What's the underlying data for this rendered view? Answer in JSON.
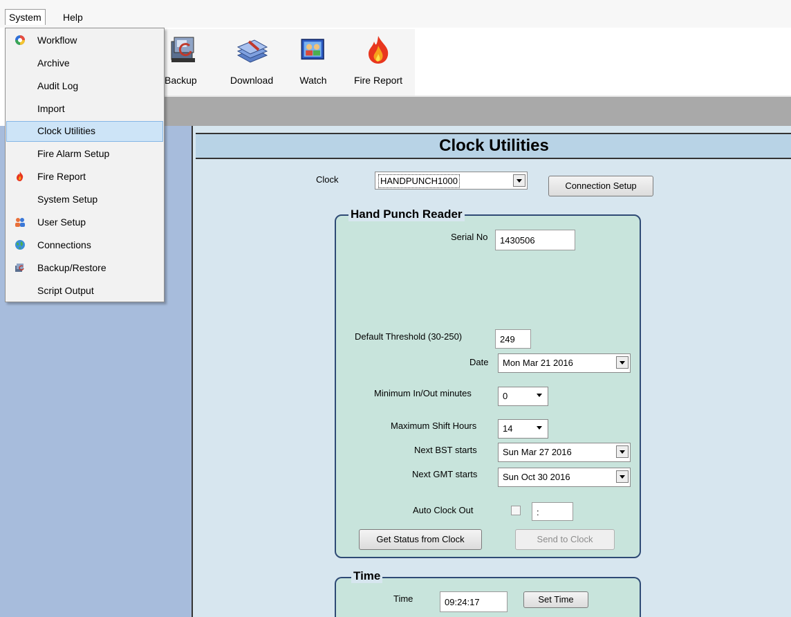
{
  "menubar": {
    "system": "System",
    "help": "Help"
  },
  "toolbar": {
    "buttons": [
      {
        "label": "Backup",
        "icon": "backup-icon"
      },
      {
        "label": "Download",
        "icon": "download-icon"
      },
      {
        "label": "Watch",
        "icon": "watch-icon"
      },
      {
        "label": "Fire Report",
        "icon": "fire-icon"
      }
    ]
  },
  "system_menu": {
    "items": [
      {
        "label": "Workflow",
        "icon": "workflow-icon"
      },
      {
        "label": "Archive"
      },
      {
        "label": "Audit Log"
      },
      {
        "label": "Import"
      },
      {
        "label": "Clock Utilities",
        "selected": true
      },
      {
        "label": "Fire Alarm Setup"
      },
      {
        "label": "Fire Report",
        "icon": "fire-icon"
      },
      {
        "label": "System Setup"
      },
      {
        "label": "User Setup",
        "icon": "users-icon"
      },
      {
        "label": "Connections",
        "icon": "globe-icon"
      },
      {
        "label": "Backup/Restore",
        "icon": "backup-icon"
      },
      {
        "label": "Script Output"
      }
    ]
  },
  "page": {
    "title": "Clock Utilities",
    "clock_label": "Clock",
    "clock_value": "HANDPUNCH1000",
    "connection_setup_label": "Connection Setup"
  },
  "reader": {
    "group_title": "Hand Punch Reader",
    "serial_label": "Serial No",
    "serial_value": "1430506",
    "threshold_label": "Default Threshold (30-250)",
    "threshold_value": "249",
    "date_label": "Date",
    "date_value": "Mon Mar 21 2016",
    "min_inout_label": "Minimum In/Out minutes",
    "min_inout_value": "0",
    "max_shift_label": "Maximum Shift Hours",
    "max_shift_value": "14",
    "bst_label": "Next BST starts",
    "bst_value": "Sun Mar 27 2016",
    "gmt_label": "Next GMT starts",
    "gmt_value": "Sun Oct 30 2016",
    "auto_clock_label": "Auto Clock Out",
    "auto_clock_time": ":",
    "get_status_label": "Get Status from Clock",
    "send_label": "Send to Clock"
  },
  "time_group": {
    "group_title": "Time",
    "time_label": "Time",
    "time_value": "09:24:17",
    "set_time_label": "Set Time"
  },
  "colors": {
    "content_bg": "#d7e6ef",
    "title_bar": "#b8d3e6",
    "group_bg": "#c8e4dc",
    "group_border": "#2e4a75",
    "left_panel": "#a7bcdc",
    "selected_item": "#cde4f7"
  }
}
